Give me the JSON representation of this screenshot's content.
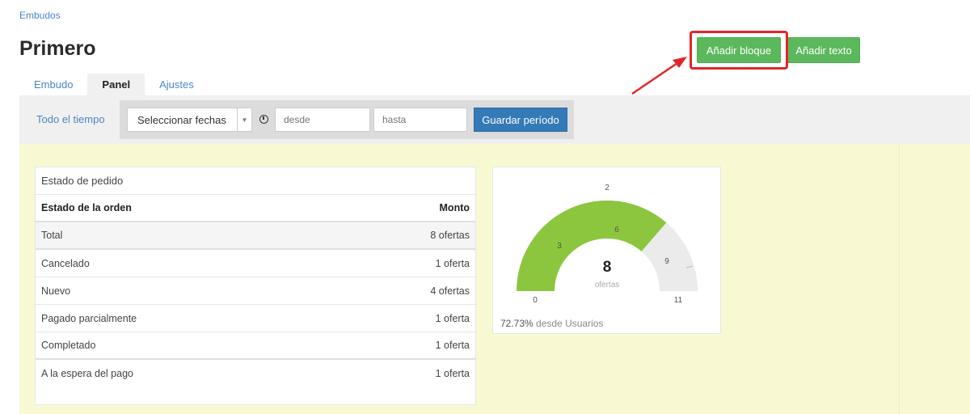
{
  "breadcrumb": "Embudos",
  "title": "Primero",
  "actions": {
    "add_block": "Añadir bloque",
    "add_text": "Añadir texto"
  },
  "tabs": [
    {
      "label": "Embudo",
      "active": false
    },
    {
      "label": "Panel",
      "active": true
    },
    {
      "label": "Ajustes",
      "active": false
    }
  ],
  "filter": {
    "all_time": "Todo el tiempo",
    "select_value": "Seleccionar fechas",
    "from_placeholder": "desde",
    "to_placeholder": "hasta",
    "save_label": "Guardar período"
  },
  "table": {
    "title": "Estado de pedido",
    "col_status": "Estado de la orden",
    "col_amount": "Monto",
    "rows": [
      {
        "status": "Total",
        "amount": "8 ofertas"
      },
      {
        "status": "Cancelado",
        "amount": "1 oferta"
      },
      {
        "status": "Nuevo",
        "amount": "4 ofertas"
      },
      {
        "status": "Pagado parcialmente",
        "amount": "1 oferta"
      },
      {
        "status": "Completado",
        "amount": "1 oferta"
      },
      {
        "status": "A la espera del pago",
        "amount": "1 oferta"
      }
    ]
  },
  "gauge": {
    "value": 8,
    "min": 0,
    "max": 11,
    "value_label": "8",
    "unit": "ofertas",
    "ticks": [
      {
        "value": 0,
        "label": "0"
      },
      {
        "value": 3,
        "label": "3"
      },
      {
        "value": 6,
        "label": "6"
      },
      {
        "value": 9,
        "label": "9"
      },
      {
        "value": 11,
        "label": "11"
      }
    ],
    "top_label": "2",
    "percent": "72.73%",
    "footer_text": "desde Usuarios",
    "fill_color": "#8cc63e",
    "track_color": "#ebebeb"
  },
  "colors": {
    "green": "#5cb85c",
    "blue": "#337ab7",
    "dashboard_bg": "#f8f9d2",
    "highlight": "#e0262a"
  }
}
